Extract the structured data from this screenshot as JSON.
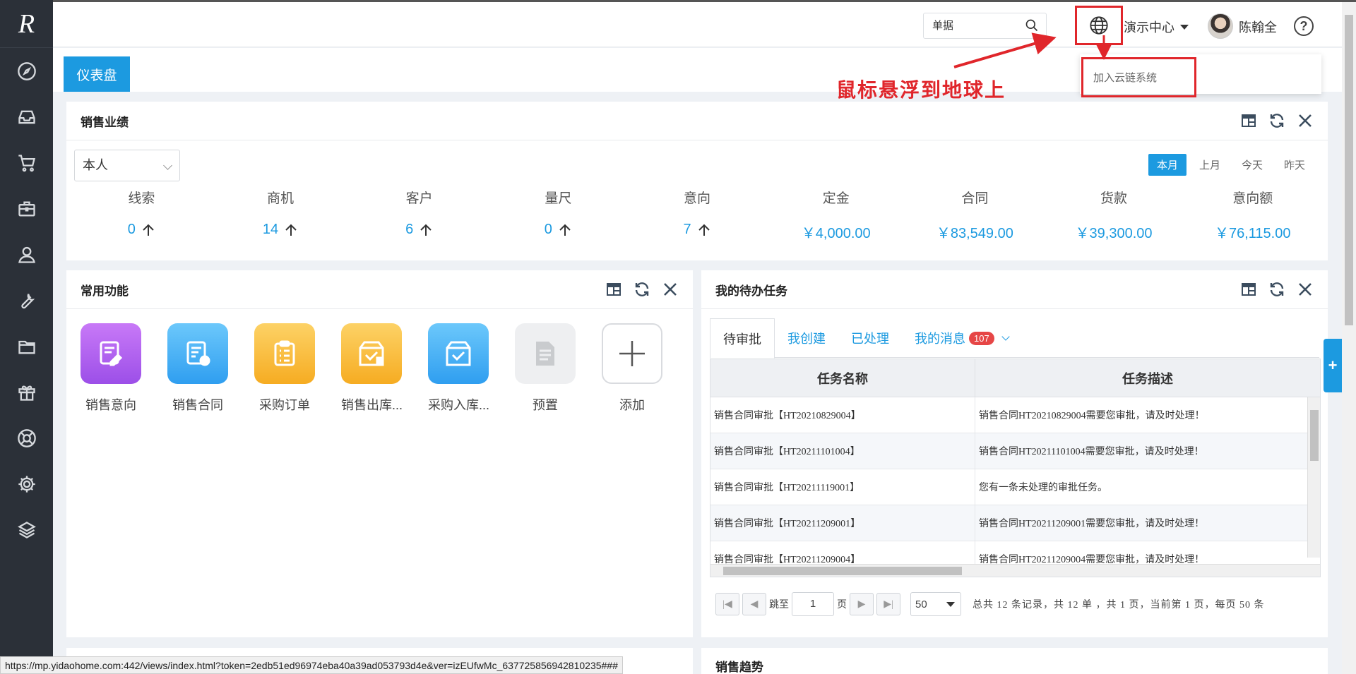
{
  "logo": "R",
  "header": {
    "search_value": "单据",
    "org_name": "演示中心",
    "user_name": "陈翰全",
    "help_label": "?"
  },
  "globe_menu": {
    "item": "加入云链系统"
  },
  "annotation": "鼠标悬浮到地球上",
  "tabs": {
    "active": "仪表盘"
  },
  "sales": {
    "title": "销售业绩",
    "scope": "本人",
    "periods": [
      "本月",
      "上月",
      "今天",
      "昨天"
    ],
    "metrics": [
      {
        "label": "线索",
        "value": "0"
      },
      {
        "label": "商机",
        "value": "14"
      },
      {
        "label": "客户",
        "value": "6"
      },
      {
        "label": "量尺",
        "value": "0"
      },
      {
        "label": "意向",
        "value": "7"
      },
      {
        "label": "定金",
        "value": "￥4,000.00"
      },
      {
        "label": "合同",
        "value": "￥83,549.00"
      },
      {
        "label": "货款",
        "value": "￥39,300.00"
      },
      {
        "label": "意向额",
        "value": "￥76,115.00"
      }
    ]
  },
  "common": {
    "title": "常用功能",
    "apps": [
      {
        "label": "销售意向",
        "color": "#b05ff0"
      },
      {
        "label": "销售合同",
        "color": "#3fb0f5"
      },
      {
        "label": "采购订单",
        "color": "#f8b838"
      },
      {
        "label": "销售出库...",
        "color": "#f8b838"
      },
      {
        "label": "采购入库...",
        "color": "#3fb0f5"
      },
      {
        "label": "预置",
        "color": "#eeeff1"
      },
      {
        "label": "添加",
        "color": "#ffffff"
      }
    ]
  },
  "tasks": {
    "title": "我的待办任务",
    "tabs": [
      "待审批",
      "我创建",
      "已处理",
      "我的消息"
    ],
    "badge": "107",
    "columns": [
      "任务名称",
      "任务描述"
    ],
    "rows": [
      {
        "name": "销售合同审批【HT20210829004】",
        "desc": "销售合同HT20210829004需要您审批，请及时处理！"
      },
      {
        "name": "销售合同审批【HT20211101004】",
        "desc": "销售合同HT20211101004需要您审批，请及时处理！"
      },
      {
        "name": "销售合同审批【HT20211119001】",
        "desc": "您有一条未处理的审批任务。"
      },
      {
        "name": "销售合同审批【HT20211209001】",
        "desc": "销售合同HT20211209001需要您审批，请及时处理！"
      },
      {
        "name": "销售合同审批【HT20211209004】",
        "desc": "销售合同HT20211209004需要您审批，请及时处理！"
      }
    ],
    "pager": {
      "jump_to": "跳至",
      "page_value": "1",
      "page_unit": "页",
      "page_size": "50",
      "summary": "总共 12 条记录，共 12 单 ，共 1 页，当前第 1 页，每页 50 条"
    }
  },
  "trend": {
    "title": "销售趋势"
  },
  "status_url": "https://mp.yidaohome.com:442/views/index.html?token=2edb51ed96974eba40a39ad053793d4e&ver=izEUfwMc_637725856942810235###",
  "colors": {
    "accent": "#1c9ae0",
    "sidebar": "#2b3038",
    "annotation": "#e0262b"
  }
}
